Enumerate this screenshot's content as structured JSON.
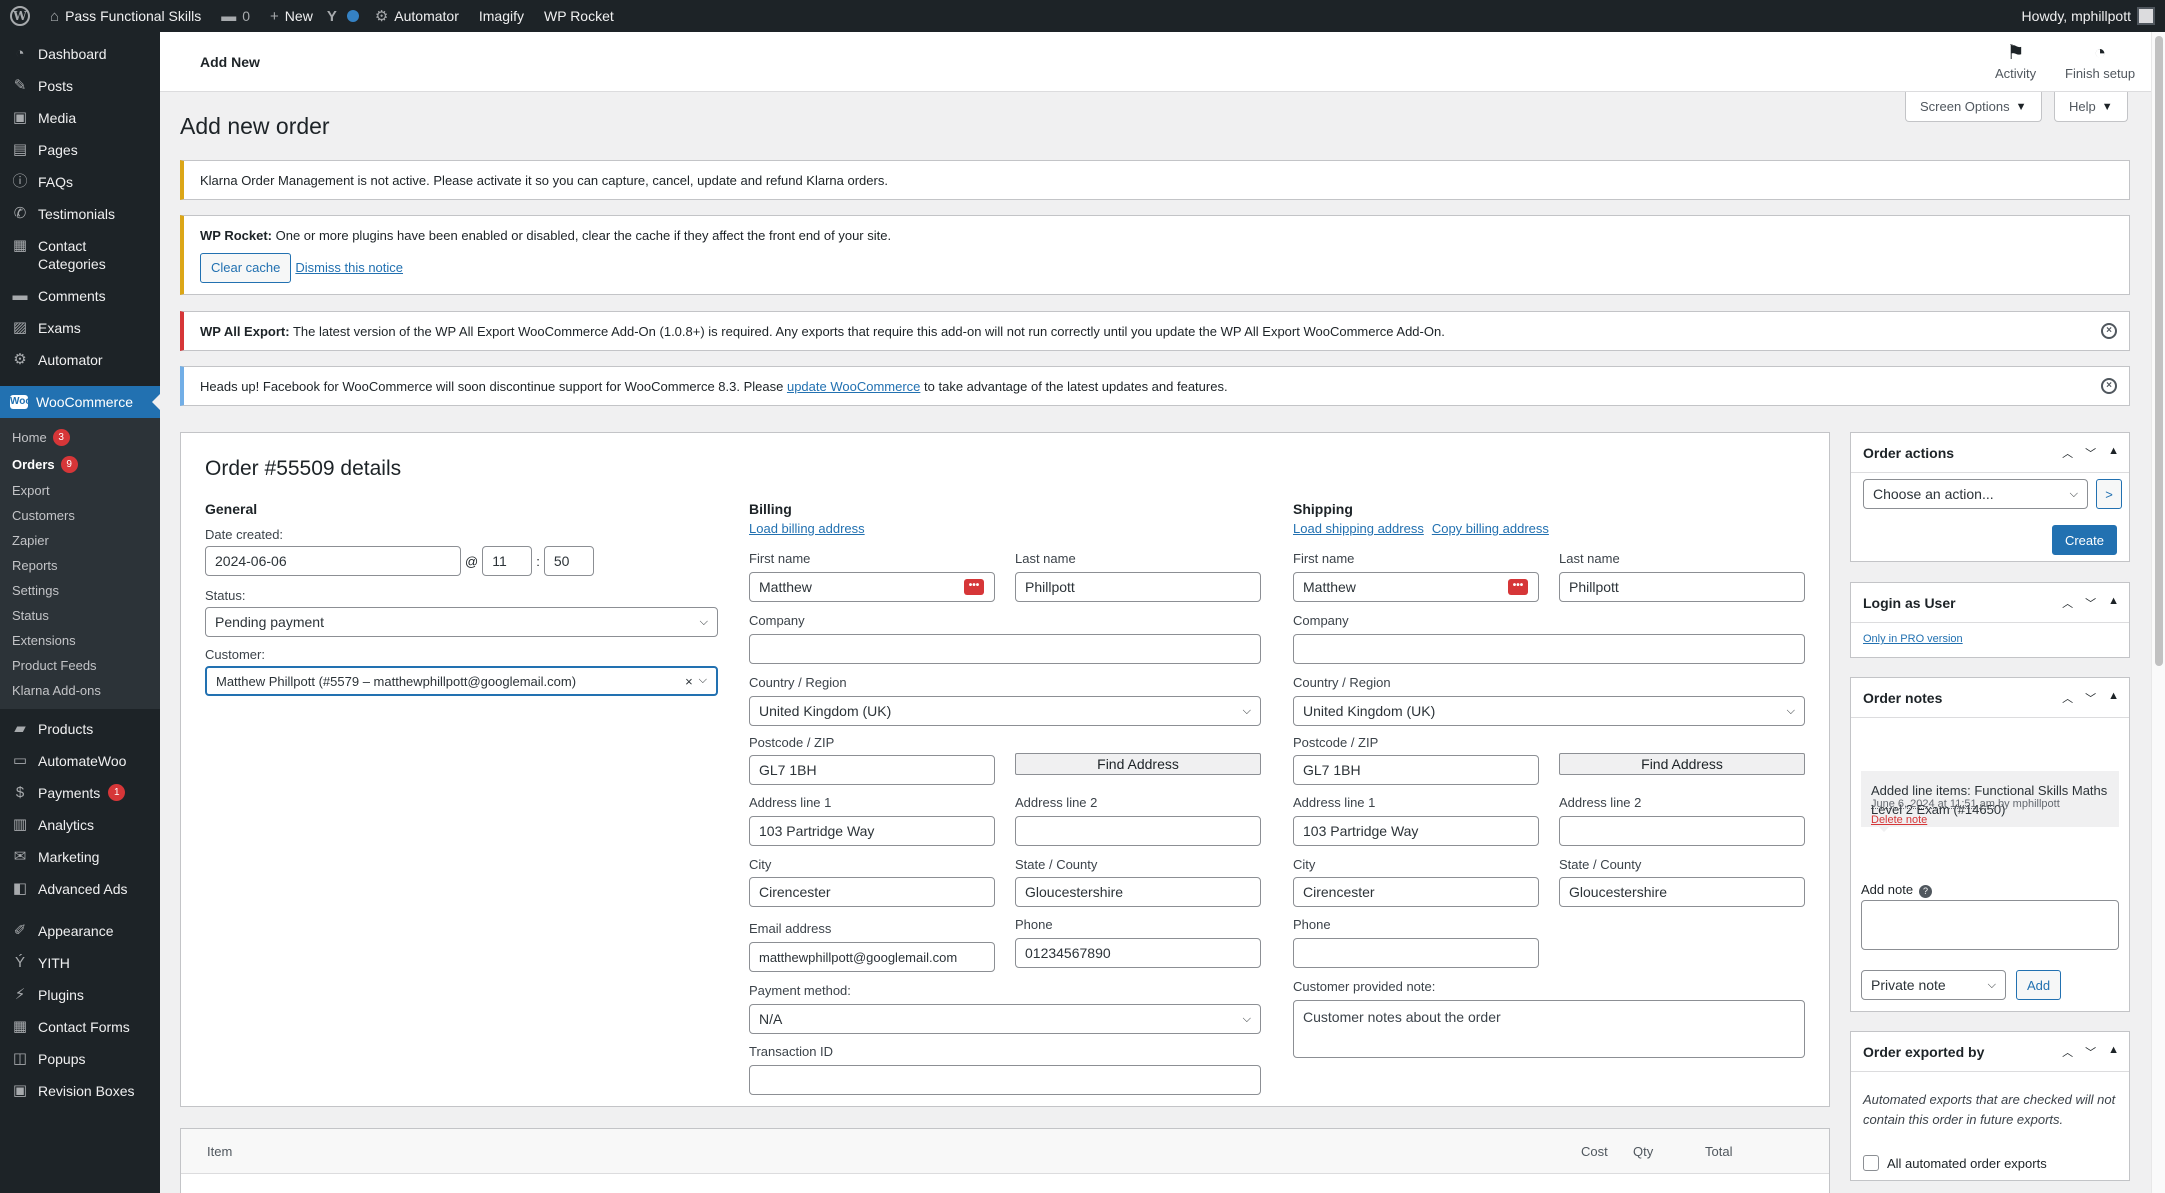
{
  "adminbar": {
    "site_name": "Pass Functional Skills",
    "comments_count": "0",
    "new_label": "New",
    "automator_label": "Automator",
    "imagify_label": "Imagify",
    "wprocket_label": "WP Rocket",
    "howdy": "Howdy, mphillpott"
  },
  "sidebar": {
    "items_top": [
      {
        "label": "Dashboard",
        "icon": "dashboard-icon",
        "glyph": "◔"
      },
      {
        "label": "Posts",
        "icon": "pin-icon",
        "glyph": "✎"
      },
      {
        "label": "Media",
        "icon": "media-icon",
        "glyph": "▣"
      },
      {
        "label": "Pages",
        "icon": "pages-icon",
        "glyph": "▤"
      },
      {
        "label": "FAQs",
        "icon": "info-icon",
        "glyph": "ⓘ"
      },
      {
        "label": "Testimonials",
        "icon": "megaphone-icon",
        "glyph": "✆"
      },
      {
        "label": "Contact Categories",
        "icon": "grid-icon",
        "glyph": "▦"
      },
      {
        "label": "Comments",
        "icon": "comment-icon",
        "glyph": "▬"
      },
      {
        "label": "Exams",
        "icon": "exam-icon",
        "glyph": "▨"
      },
      {
        "label": "Automator",
        "icon": "automator-icon",
        "glyph": "⚙"
      }
    ],
    "woocommerce_label": "WooCommerce",
    "woo_sub": [
      {
        "label": "Home",
        "badge": "3"
      },
      {
        "label": "Orders",
        "badge": "9"
      },
      {
        "label": "Export",
        "badge": ""
      },
      {
        "label": "Customers",
        "badge": ""
      },
      {
        "label": "Zapier",
        "badge": ""
      },
      {
        "label": "Reports",
        "badge": ""
      },
      {
        "label": "Settings",
        "badge": ""
      },
      {
        "label": "Status",
        "badge": ""
      },
      {
        "label": "Extensions",
        "badge": ""
      },
      {
        "label": "Product Feeds",
        "badge": ""
      },
      {
        "label": "Klarna Add-ons",
        "badge": ""
      }
    ],
    "items_bottom": [
      {
        "label": "Products",
        "icon": "products-icon",
        "glyph": "▰",
        "badge": ""
      },
      {
        "label": "AutomateWoo",
        "icon": "automatewoo-icon",
        "glyph": "▭",
        "badge": ""
      },
      {
        "label": "Payments",
        "icon": "payments-icon",
        "glyph": "$",
        "badge": "1"
      },
      {
        "label": "Analytics",
        "icon": "analytics-icon",
        "glyph": "▥",
        "badge": ""
      },
      {
        "label": "Marketing",
        "icon": "marketing-icon",
        "glyph": "✉",
        "badge": ""
      },
      {
        "label": "Advanced Ads",
        "icon": "ads-icon",
        "glyph": "◧",
        "badge": ""
      }
    ],
    "items_bottom2": [
      {
        "label": "Appearance",
        "icon": "appearance-icon",
        "glyph": "✐"
      },
      {
        "label": "YITH",
        "icon": "yith-icon",
        "glyph": "Ý"
      },
      {
        "label": "Plugins",
        "icon": "plugins-icon",
        "glyph": "⚡"
      },
      {
        "label": "Contact Forms",
        "icon": "forms-icon",
        "glyph": "▦"
      },
      {
        "label": "Popups",
        "icon": "popups-icon",
        "glyph": "◫"
      },
      {
        "label": "Revision Boxes",
        "icon": "revision-icon",
        "glyph": "▣"
      }
    ]
  },
  "header": {
    "title": "Add New",
    "activity": "Activity",
    "finish_setup": "Finish setup",
    "screen_options": "Screen Options",
    "help": "Help"
  },
  "page_title": "Add new order",
  "notices": {
    "klarna": "Klarna Order Management is not active. Please activate it so you can capture, cancel, update and refund Klarna orders.",
    "wprocket_strong": "WP Rocket:",
    "wprocket_text": " One or more plugins have been enabled or disabled, clear the cache if they affect the front end of your site.",
    "clear_cache": "Clear cache",
    "dismiss": "Dismiss this notice",
    "wpallexport_strong": "WP All Export:",
    "wpallexport_text": " The latest version of the WP All Export WooCommerce Add-On (1.0.8+) is required. Any exports that require this add-on will not run correctly until you update the WP All Export WooCommerce Add-On.",
    "facebook_pre": "Heads up! Facebook for WooCommerce will soon discontinue support for WooCommerce 8.3. Please ",
    "facebook_link": "update WooCommerce",
    "facebook_post": " to take advantage of the latest updates and features."
  },
  "order": {
    "title": "Order #55509 details",
    "general": {
      "heading": "General",
      "date_label": "Date created:",
      "date": "2024-06-06",
      "at": "@",
      "hour": "11",
      "colon": ":",
      "minute": "50",
      "status_label": "Status:",
      "status": "Pending payment",
      "customer_label": "Customer:",
      "customer": "Matthew Phillpott (#5579 – matthewphillpott@googlemail.com)"
    },
    "billing": {
      "heading": "Billing",
      "load_link": "Load billing address",
      "first_name_label": "First name",
      "first_name": "Matthew",
      "last_name_label": "Last name",
      "last_name": "Phillpott",
      "company_label": "Company",
      "company": "",
      "country_label": "Country / Region",
      "country": "United Kingdom (UK)",
      "postcode_label": "Postcode / ZIP",
      "postcode": "GL7 1BH",
      "find_address": "Find Address",
      "address1_label": "Address line 1",
      "address1": "103 Partridge Way",
      "address2_label": "Address line 2",
      "address2": "",
      "city_label": "City",
      "city": "Cirencester",
      "state_label": "State / County",
      "state": "Gloucestershire",
      "email_label": "Email address",
      "email": "matthewphillpott@googlemail.com",
      "phone_label": "Phone",
      "phone": "01234567890",
      "payment_label": "Payment method:",
      "payment": "N/A",
      "transaction_label": "Transaction ID",
      "transaction": ""
    },
    "shipping": {
      "heading": "Shipping",
      "load_link": "Load shipping address",
      "copy_link": "Copy billing address",
      "first_name_label": "First name",
      "first_name": "Matthew",
      "last_name_label": "Last name",
      "last_name": "Phillpott",
      "company_label": "Company",
      "company": "",
      "country_label": "Country / Region",
      "country": "United Kingdom (UK)",
      "postcode_label": "Postcode / ZIP",
      "postcode": "GL7 1BH",
      "find_address": "Find Address",
      "address1_label": "Address line 1",
      "address1": "103 Partridge Way",
      "address2_label": "Address line 2",
      "address2": "",
      "city_label": "City",
      "city": "Cirencester",
      "state_label": "State / County",
      "state": "Gloucestershire",
      "phone_label": "Phone",
      "phone": "",
      "note_label": "Customer provided note:",
      "note": "Customer notes about the order"
    }
  },
  "items_table": {
    "item": "Item",
    "cost": "Cost",
    "qty": "Qty",
    "total": "Total"
  },
  "order_actions": {
    "title": "Order actions",
    "select": "Choose an action...",
    "go": ">",
    "create": "Create"
  },
  "login_as_user": {
    "title": "Login as User",
    "pro_link": "Only in PRO version"
  },
  "order_notes": {
    "title": "Order notes",
    "note_text": "Added line items: Functional Skills Maths Level 2 Exam (#14650)",
    "note_date": "June 6, 2024 at 11:51 am",
    "note_by": " by mphillpott",
    "delete": "Delete note",
    "add_note_label": "Add note",
    "note_type": "Private note",
    "add_btn": "Add"
  },
  "order_exported": {
    "title": "Order exported by",
    "desc": "Automated exports that are checked will not contain this order in future exports.",
    "checkbox_label": "All automated order exports"
  }
}
